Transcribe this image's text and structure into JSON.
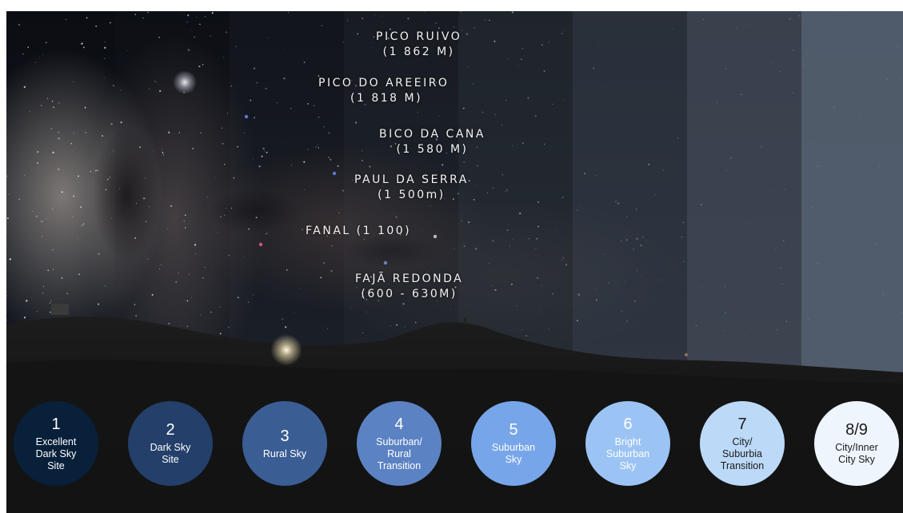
{
  "elevation_labels": [
    {
      "name": "PICO RUIVO",
      "elevation": "(1 862 M)"
    },
    {
      "name": "PICO DO AREEIRO",
      "elevation": "(1 818 M)"
    },
    {
      "name": "BICO DA CANA",
      "elevation": "(1 580 M)"
    },
    {
      "name": "PAUL DA SERRA",
      "elevation": "(1 500m)"
    },
    {
      "name": "FANAL (1 100)",
      "elevation": ""
    },
    {
      "name": "FAJÃ REDONDA",
      "elevation": "(600 - 630M)"
    }
  ],
  "scale_levels": [
    {
      "number": "1",
      "label": "Excellent\nDark Sky\nSite",
      "color": "#08203a",
      "text_color": "#ffffff"
    },
    {
      "number": "2",
      "label": "Dark Sky\nSite",
      "color": "#233f6a",
      "text_color": "#ffffff"
    },
    {
      "number": "3",
      "label": "Rural Sky",
      "color": "#3a5d94",
      "text_color": "#ffffff"
    },
    {
      "number": "4",
      "label": "Suburban/\nRural\nTransition",
      "color": "#5b82c3",
      "text_color": "#ffffff"
    },
    {
      "number": "5",
      "label": "Suburban\nSky",
      "color": "#77a5ea",
      "text_color": "#ffffff"
    },
    {
      "number": "6",
      "label": "Bright\nSuburban\nSky",
      "color": "#9bc3f4",
      "text_color": "#ffffff"
    },
    {
      "number": "7",
      "label": "City/\nSuburbia\nTransition",
      "color": "#bcd9f8",
      "text_color": "#1a1a1a"
    },
    {
      "number": "8/9",
      "label": "City/Inner\nCity Sky",
      "color": "#eef5fd",
      "text_color": "#1a1a1a"
    }
  ]
}
